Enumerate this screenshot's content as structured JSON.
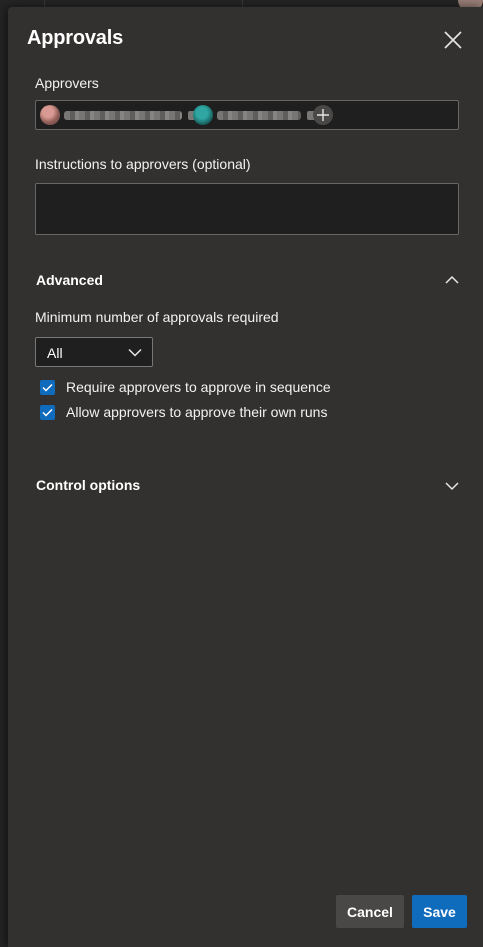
{
  "panel": {
    "title": "Approvals",
    "close_icon": "close-icon"
  },
  "approvers": {
    "label": "Approvers",
    "personas": [
      {
        "avatar_color": "#b46b62"
      },
      {
        "avatar_color": "#1f7a78"
      }
    ],
    "add_icon": "plus-icon"
  },
  "instructions": {
    "label": "Instructions to approvers (optional)",
    "value": "",
    "placeholder": ""
  },
  "advanced": {
    "heading": "Advanced",
    "expanded": true,
    "min_label": "Minimum number of approvals required",
    "min_value": "All",
    "checkboxes": [
      {
        "label": "Require approvers to approve in sequence",
        "checked": true
      },
      {
        "label": "Allow approvers to approve their own runs",
        "checked": true
      }
    ]
  },
  "control_options": {
    "heading": "Control options",
    "expanded": false
  },
  "footer": {
    "cancel_label": "Cancel",
    "save_label": "Save"
  },
  "colors": {
    "accent": "#0f6cbd",
    "panel_bg": "#333130",
    "input_bg": "#1f1f1f"
  }
}
